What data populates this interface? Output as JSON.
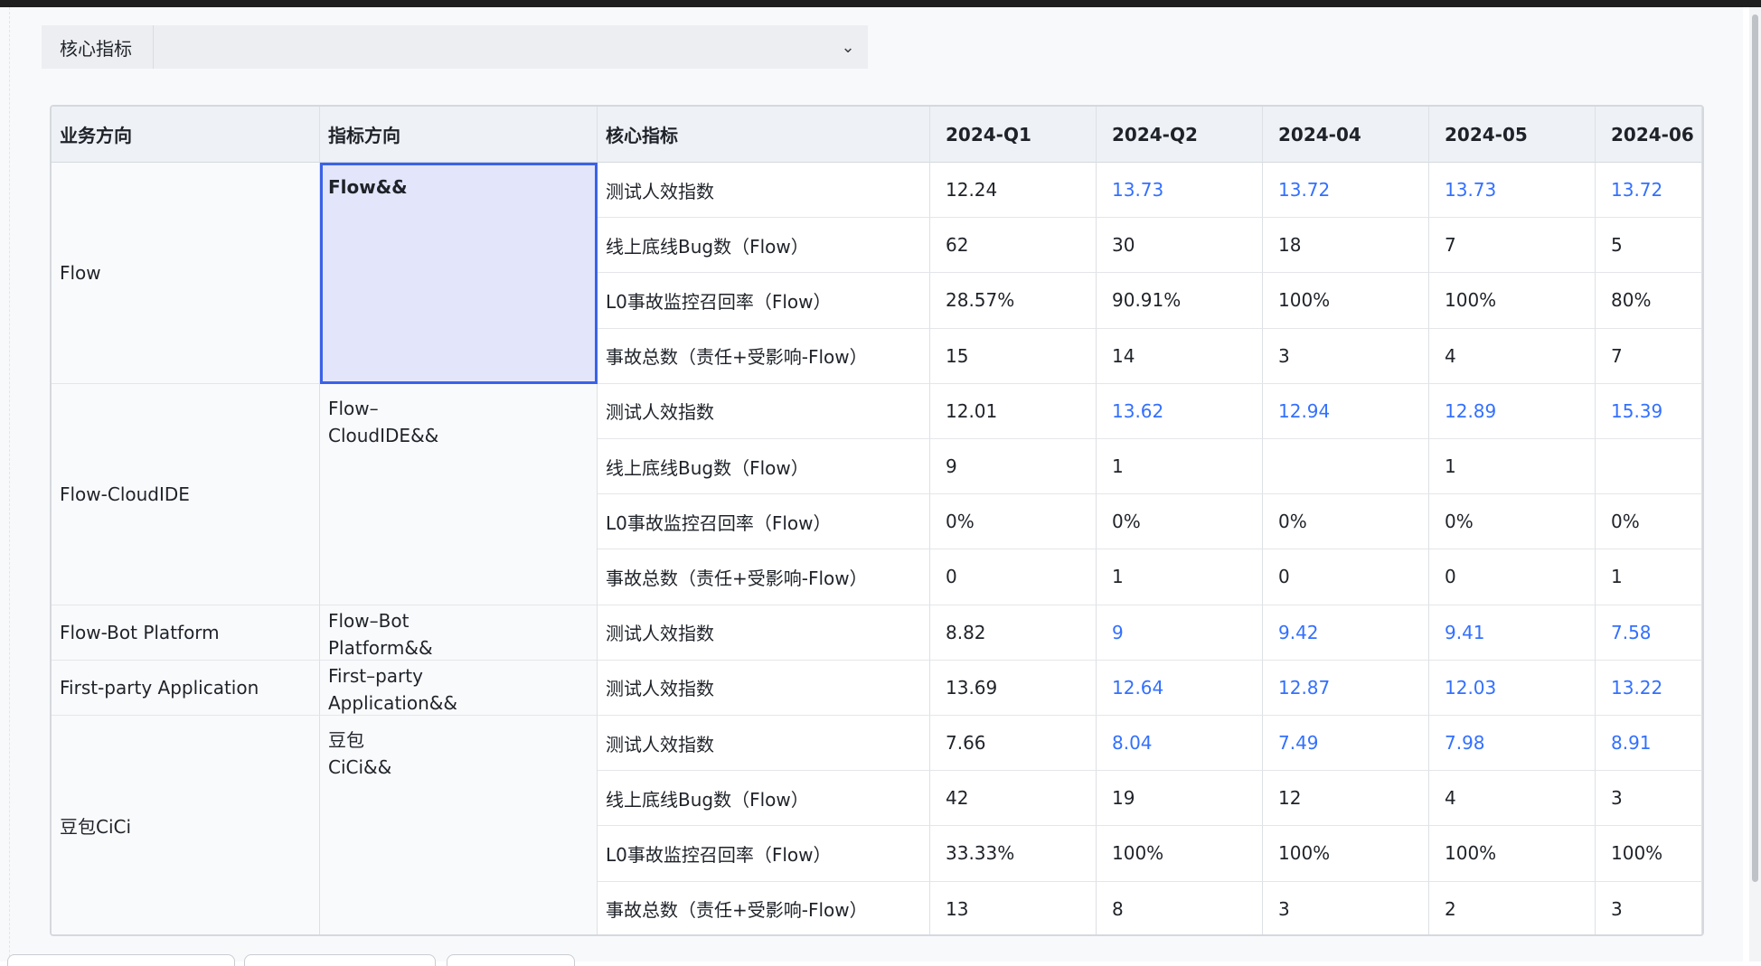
{
  "filter": {
    "label": "核心指标",
    "value": ""
  },
  "columns": [
    "业务方向",
    "指标方向",
    "核心指标",
    "2024-Q1",
    "2024-Q2",
    "2024-04",
    "2024-05",
    "2024-06"
  ],
  "groups": [
    {
      "business": "Flow",
      "direction": [
        "Flow&&"
      ],
      "selected": true,
      "rows": [
        {
          "metric": "测试人效指数",
          "values": [
            "12.24",
            "13.73",
            "13.72",
            "13.73",
            "13.72"
          ],
          "linked": true
        },
        {
          "metric": "线上底线Bug数（Flow）",
          "values": [
            "62",
            "30",
            "18",
            "7",
            "5"
          ],
          "linked": false
        },
        {
          "metric": "L0事故监控召回率（Flow）",
          "values": [
            "28.57%",
            "90.91%",
            "100%",
            "100%",
            "80%"
          ],
          "linked": false
        },
        {
          "metric": "事故总数（责任+受影响-Flow）",
          "values": [
            "15",
            "14",
            "3",
            "4",
            "7"
          ],
          "linked": false
        }
      ]
    },
    {
      "business": "Flow-CloudIDE",
      "direction": [
        "Flow–",
        "CloudIDE&&"
      ],
      "selected": false,
      "rows": [
        {
          "metric": "测试人效指数",
          "values": [
            "12.01",
            "13.62",
            "12.94",
            "12.89",
            "15.39"
          ],
          "linked": true
        },
        {
          "metric": "线上底线Bug数（Flow）",
          "values": [
            "9",
            "1",
            "",
            "1",
            ""
          ],
          "linked": false
        },
        {
          "metric": "L0事故监控召回率（Flow）",
          "values": [
            "0%",
            "0%",
            "0%",
            "0%",
            "0%"
          ],
          "linked": false
        },
        {
          "metric": "事故总数（责任+受影响-Flow）",
          "values": [
            "0",
            "1",
            "0",
            "0",
            "1"
          ],
          "linked": false
        }
      ]
    },
    {
      "business": "Flow-Bot Platform",
      "direction": [
        "Flow–Bot",
        "Platform&&"
      ],
      "selected": false,
      "rows": [
        {
          "metric": "测试人效指数",
          "values": [
            "8.82",
            "9",
            "9.42",
            "9.41",
            "7.58"
          ],
          "linked": true
        }
      ]
    },
    {
      "business": "First-party Application",
      "direction": [
        "First–party",
        "Application&&"
      ],
      "selected": false,
      "rows": [
        {
          "metric": "测试人效指数",
          "values": [
            "13.69",
            "12.64",
            "12.87",
            "12.03",
            "13.22"
          ],
          "linked": true
        }
      ]
    },
    {
      "business": "豆包CiCi",
      "direction": [
        "豆包",
        "CiCi&&"
      ],
      "selected": false,
      "rows": [
        {
          "metric": "测试人效指数",
          "values": [
            "7.66",
            "8.04",
            "7.49",
            "7.98",
            "8.91"
          ],
          "linked": true
        },
        {
          "metric": "线上底线Bug数（Flow）",
          "values": [
            "42",
            "19",
            "12",
            "4",
            "3"
          ],
          "linked": false
        },
        {
          "metric": "L0事故监控召回率（Flow）",
          "values": [
            "33.33%",
            "100%",
            "100%",
            "100%",
            "100%"
          ],
          "linked": false
        },
        {
          "metric": "事故总数（责任+受影响-Flow）",
          "values": [
            "13",
            "8",
            "3",
            "2",
            "3"
          ],
          "linked": false
        }
      ]
    }
  ],
  "colors": {
    "link": "#3370ff",
    "selection": "#3a62e8"
  },
  "icons": {
    "dropdown": "chevron-down-icon"
  }
}
